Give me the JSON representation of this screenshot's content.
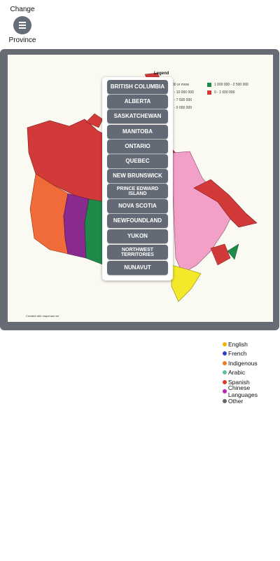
{
  "header": {
    "label_top": "Change",
    "label_bottom": "Province",
    "menu_icon": "hamburger-icon"
  },
  "map": {
    "legend_title": "Legend",
    "legend_items": [
      {
        "label": "0 000 or more",
        "color": "#8a2a8f"
      },
      {
        "label": "1 000 000 - 2 500 000",
        "color": "#1f8a4a"
      },
      {
        "label": "000 - 10 000 000",
        "color": "#f06a3a"
      },
      {
        "label": "0 - 1 000 000",
        "color": "#d23a3a"
      },
      {
        "label": "000 - 7 500 000",
        "color": "#f3a0c8"
      },
      {
        "label": "000 - 5 000 000",
        "color": "#f3e82a"
      }
    ],
    "credit": "Created with mapchart.net"
  },
  "province_menu": [
    "BRITISH COLUMBIA",
    "ALBERTA",
    "SASKATCHEWAN",
    "MANITOBA",
    "ONTARIO",
    "QUEBEC",
    "NEW BRUNSWICK",
    "PRINCE EDWARD ISLAND",
    "NOVA SCOTIA",
    "NEWFOUNDLAND",
    "YUKON",
    "NORTHWEST TERRITORIES",
    "NUNAVUT"
  ],
  "language_legend": [
    {
      "label": "English",
      "color": "#f0b400"
    },
    {
      "label": "French",
      "color": "#2a3fd1"
    },
    {
      "label": "Indigenous",
      "color": "#f07a2a"
    },
    {
      "label": "Arabic",
      "color": "#5bbfa8"
    },
    {
      "label": "Spanish",
      "color": "#d63a2a"
    },
    {
      "label": "Chinese Languages",
      "color": "#c21fb8"
    },
    {
      "label": "Other",
      "color": "#666666"
    }
  ]
}
